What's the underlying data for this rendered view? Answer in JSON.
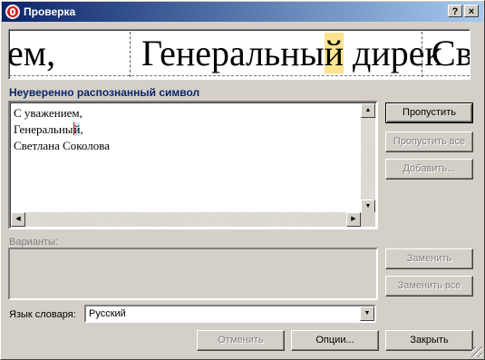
{
  "window": {
    "title": "Проверка"
  },
  "titlebar_buttons": {
    "help": "?",
    "close": "×"
  },
  "preview": {
    "before": "ем,   ",
    "word_start": "Генеральны",
    "highlight_char": "й",
    "after": " дирек",
    "next": "Св"
  },
  "section": {
    "title": "Неуверенно распознанный символ"
  },
  "editor": {
    "line1": "С уважением,",
    "line2_start": "Генеральны",
    "line2_highlight": "й",
    "line2_end": ",",
    "line3": "Светлана Соколова"
  },
  "buttons": {
    "skip": "Пропустить",
    "skip_all": "Пропустить все",
    "add": "Добавить...",
    "replace": "Заменить",
    "replace_all": "Заменить все",
    "undo": "Отменить",
    "options": "Опции...",
    "close": "Закрыть"
  },
  "variants": {
    "label": "Варианты:"
  },
  "language": {
    "label": "Язык словаря:",
    "value": "Русский"
  },
  "colors": {
    "title_start": "#0a246a",
    "title_end": "#a6caf0",
    "highlight": "#ffe38a",
    "section_title": "#0a246a"
  },
  "icons": {
    "app": "red-stop-icon"
  }
}
